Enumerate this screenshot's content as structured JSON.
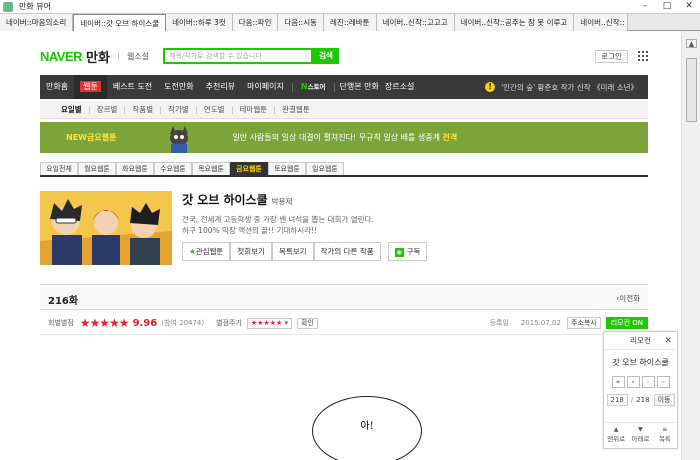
{
  "window": {
    "title": "만화 뷰어"
  },
  "tabs": [
    {
      "label": "네이버::마음의소리"
    },
    {
      "label": "네이버::갓 오브 하이스쿨"
    },
    {
      "label": "네이버::하루 3컷"
    },
    {
      "label": "다음::파인"
    },
    {
      "label": "다음::시동"
    },
    {
      "label": "레진::레바툰"
    },
    {
      "label": "네이버..신작::고고고"
    },
    {
      "label": "네이버..신작::공주는 잠 못 이루고"
    },
    {
      "label": "네이버..신작::"
    }
  ],
  "header": {
    "logo_brand": "NAVER",
    "logo_service": "만화",
    "novel_link": "웹소설",
    "search_placeholder": "제목/작가로 검색할 수 있습니다",
    "search_button": "검색",
    "login": "로그인"
  },
  "nav": {
    "items": [
      "만화홈",
      "웹툰",
      "베스트 도전",
      "도전만화",
      "추천리뷰",
      "마이페이지"
    ],
    "store_n": "N",
    "store_label": "스토어",
    "extra": [
      "단행본 만화",
      "장르소설"
    ],
    "notice": "'인간의 숲' 황준호 작가 신작 《미래 소년》"
  },
  "subnav": {
    "items": [
      "요일별",
      "장르별",
      "작품별",
      "작가별",
      "연도별",
      "테마웹툰",
      "완결웹툰"
    ]
  },
  "banner": {
    "tag": "NEW금요웹툰",
    "text": "일반 사람들의 일상 대결이 펼쳐진다! 무규칙 일상 배틀 생중계 ",
    "highlight": "전격"
  },
  "daytabs": [
    "요일전체",
    "월요웹툰",
    "화요웹툰",
    "수요웹툰",
    "목요웹툰",
    "금요웹툰",
    "토요웹툰",
    "일요웹툰"
  ],
  "comic": {
    "title": "갓 오브 하이스쿨",
    "author": "박용제",
    "desc_line1": "전국, 전세계 고등학생 중 가장 쎈 녀석을 뽑는 대회가 열린다.",
    "desc_line2": "허구 100% 막장 액션의 끝!! 기대하시라!!",
    "buttons": {
      "favorite": "관심웹툰",
      "first": "첫회보기",
      "list": "목록보기",
      "other": "작가의 다른 작품",
      "rss": "구독"
    }
  },
  "episode": {
    "title": "216화",
    "prev": "이전화",
    "rating_label": "회별별점",
    "stars": "★★★★★",
    "score": "9.96",
    "participants": "(참여 20474)",
    "give_label": "별점주기",
    "give_value": "★★★★★",
    "confirm": "확인",
    "reg_label": "등록일",
    "reg_date": "2015.07.02",
    "url_copy": "주소복사",
    "remote_on": "리모컨 ON"
  },
  "remote": {
    "header": "리모컨",
    "title": "갓 오브 하이스쿨",
    "arrows": [
      "«",
      "‹",
      "›",
      "»"
    ],
    "current": "218",
    "total": "218",
    "go": "이동",
    "bottom": [
      "맨위로",
      "아래로",
      "목록"
    ]
  },
  "comic_page": {
    "bubble_text": "아!"
  },
  "colors": {
    "naver_green": "#1ec800",
    "nav_dark": "#3a3a3a",
    "banner_green": "#7ca43a",
    "star_red": "#e23"
  }
}
